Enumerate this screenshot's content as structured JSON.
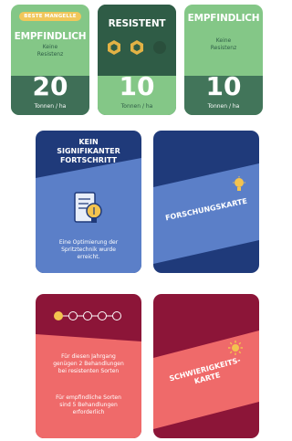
{
  "variety_cards": [
    {
      "badge": "BESTE MANGELLE",
      "title": "EMPFINDLICH",
      "subtitle": [
        "Keine",
        "Resistenz"
      ],
      "yield": "20",
      "unit": "Tonnen / ha"
    },
    {
      "title": "RESISTENT",
      "yield": "10",
      "unit": "Tonnen / ha"
    },
    {
      "title": "EMPFINDLICH",
      "subtitle": [
        "Keine",
        "Resistenz"
      ],
      "yield": "10",
      "unit": "Tonnen / ha"
    }
  ],
  "research_cards": [
    {
      "title": [
        "KEIN",
        "SIGNIFIKANTER",
        "FORTSCHRITT"
      ],
      "icon": "document-lightbulb-icon",
      "description": [
        "Eine Optimierung der",
        "Spritztechnik wurde",
        "erreicht."
      ]
    },
    {
      "label": "FORSCHUNGSKARTE",
      "icon": "lightbulb-icon"
    }
  ],
  "treatment_cards": [
    {
      "progress": {
        "total": 5,
        "filled": 1
      },
      "text_1": [
        "Für diesen Jahrgang",
        "genügen 2 Behandlungen",
        "bei resistenten Sorten"
      ],
      "text_2": [
        "Für empfindliche Sorten",
        "sind 5 Behandlungen",
        "erforderlich"
      ]
    },
    {
      "label": [
        "SCHWIERIGKEITS-",
        "KARTE"
      ],
      "icon": "sun-gear-icon"
    }
  ],
  "colors": {
    "green_light": "#84c787",
    "green_dark": "#3f6f57",
    "badge_yellow": "#f1c75a",
    "blue_dark": "#1f3a7a",
    "blue_light": "#5b7fc8",
    "red_dark": "#8c1538",
    "red_light": "#ef6a6a",
    "accent_yellow": "#f3c34f"
  }
}
